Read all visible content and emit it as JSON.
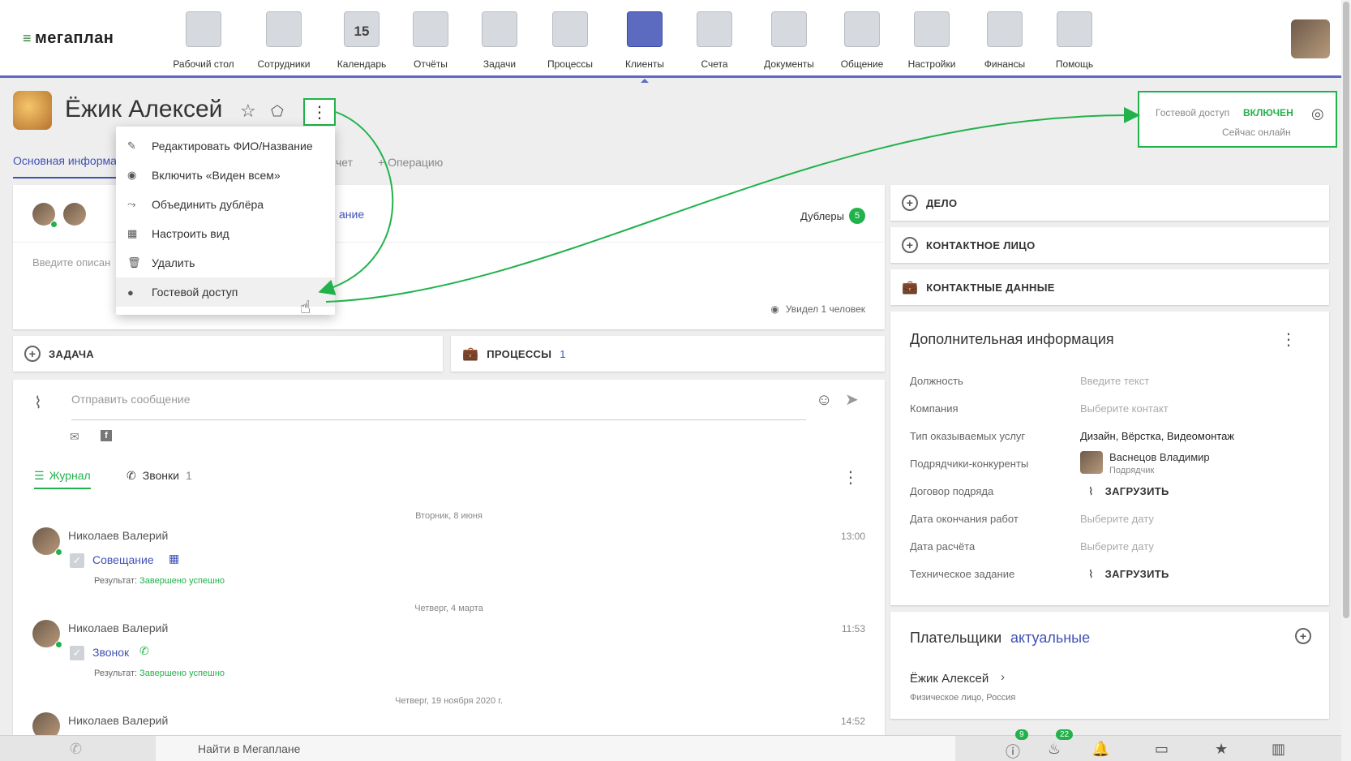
{
  "logo": {
    "text": "мегаплан",
    "mark": "≡"
  },
  "nav": [
    {
      "label": "Рабочий стол",
      "icon": "desktop-icon"
    },
    {
      "label": "Сотрудники",
      "icon": "employees-icon"
    },
    {
      "label": "Календарь",
      "icon": "calendar-icon",
      "sub": "15"
    },
    {
      "label": "Отчёты",
      "icon": "reports-icon"
    },
    {
      "label": "Задачи",
      "icon": "tasks-icon"
    },
    {
      "label": "Процессы",
      "icon": "processes-icon"
    },
    {
      "label": "Клиенты",
      "icon": "clients-icon",
      "active": true
    },
    {
      "label": "Счета",
      "icon": "invoices-icon"
    },
    {
      "label": "Документы",
      "icon": "documents-icon"
    },
    {
      "label": "Общение",
      "icon": "chat-icon"
    },
    {
      "label": "Настройки",
      "icon": "gear-icon"
    },
    {
      "label": "Финансы",
      "icon": "safe-icon"
    },
    {
      "label": "Помощь",
      "icon": "lifebuoy-icon"
    }
  ],
  "client": {
    "name": "Ёжик Алексей"
  },
  "tabs": {
    "main": "Основная информа",
    "report": "чет",
    "add_op": "+ Операцию"
  },
  "menu": {
    "items": [
      {
        "label": "Редактировать ФИО/Название",
        "icon": "✎"
      },
      {
        "label": "Включить «Виден всем»",
        "icon": "◉"
      },
      {
        "label": "Объединить дублёра",
        "icon": "⤳"
      },
      {
        "label": "Настроить вид",
        "icon": "▦"
      },
      {
        "label": "Удалить",
        "icon": "🗑"
      },
      {
        "label": "Гостевой доступ",
        "icon": "●"
      }
    ]
  },
  "guest": {
    "label": "Гостевой доступ",
    "status": "ВКЛЮЧЕН",
    "online": "Сейчас онлайн"
  },
  "info_card": {
    "duplicates_label": "Дублеры",
    "duplicates_count": "5",
    "link_fragment": "ание",
    "desc_placeholder": "Введите описан",
    "seen": "Увидел 1 человек"
  },
  "actions": {
    "task": "ЗАДАЧА",
    "processes": "ПРОЦЕССЫ",
    "processes_count": "1"
  },
  "composer": {
    "placeholder": "Отправить сообщение"
  },
  "journal": {
    "tab_journal": "Журнал",
    "tab_calls": "Звонки",
    "calls_count": "1"
  },
  "log": [
    {
      "date": "Вторник, 8 июня",
      "author": "Николаев Валерий",
      "time": "13:00",
      "title": "Совещание",
      "result_label": "Результат:",
      "result": "Завершено успешно"
    },
    {
      "date": "Четверг, 4 марта",
      "author": "Николаев Валерий",
      "time": "11:53",
      "title": "Звонок",
      "result_label": "Результат:",
      "result": "Завершено успешно"
    },
    {
      "date": "Четверг, 19 ноября 2020 г.",
      "author": "Николаев Валерий",
      "time": "14:52"
    }
  ],
  "right": {
    "delo": "ДЕЛО",
    "contact_person": "КОНТАКТНОЕ ЛИЦО",
    "contact_data": "КОНТАКТНЫЕ ДАННЫЕ",
    "extra_title": "Дополнительная информация",
    "fields": [
      {
        "label": "Должность",
        "value": "Введите текст",
        "placeholder": true
      },
      {
        "label": "Компания",
        "value": "Выберите контакт",
        "placeholder": true
      },
      {
        "label": "Тип оказываемых услуг",
        "value": "Дизайн, Вёрстка, Видеомонтаж"
      },
      {
        "label": "Подрядчики-конкуренты",
        "value": "Васнецов Владимир",
        "sub": "Подрядчик"
      },
      {
        "label": "Договор подряда",
        "value": "ЗАГРУЗИТЬ",
        "upload": true
      },
      {
        "label": "Дата окончания работ",
        "value": "Выберите дату",
        "placeholder": true
      },
      {
        "label": "Дата расчёта",
        "value": "Выберите дату",
        "placeholder": true
      },
      {
        "label": "Техническое задание",
        "value": "ЗАГРУЗИТЬ",
        "upload": true
      }
    ],
    "payers_title": "Плательщики",
    "payers_filter": "актуальные",
    "payer_name": "Ёжик Алексей",
    "payer_sub": "Физическое лицо, Россия"
  },
  "bottom": {
    "search": "Найти в Мегаплане",
    "badge1": "9",
    "badge2": "22"
  },
  "colors": {
    "accent": "#3f51b5",
    "green": "#22b24c",
    "nav_line": "#5c6bc0"
  }
}
